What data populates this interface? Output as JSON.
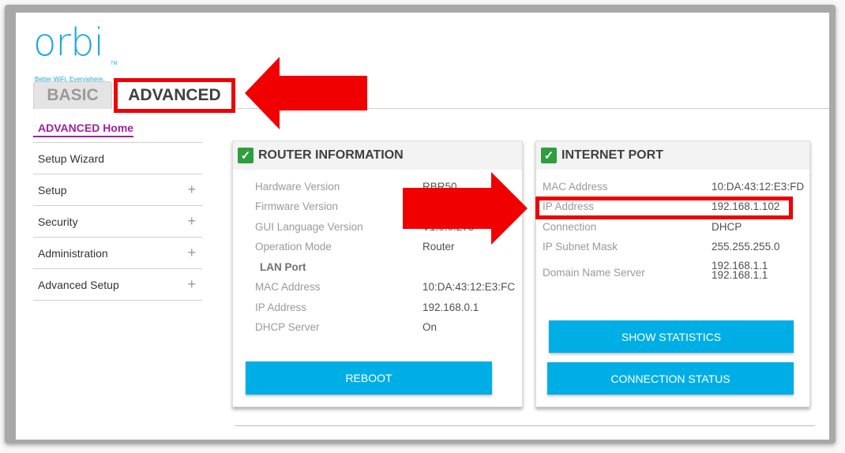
{
  "brand": {
    "logo_text": "orbi",
    "trademark": "TM",
    "tagline": "Better WiFi. Everywhere."
  },
  "tabs": [
    {
      "label": "BASIC",
      "active": false
    },
    {
      "label": "ADVANCED",
      "active": true
    }
  ],
  "sidebar": {
    "home": "ADVANCED Home",
    "items": [
      {
        "label": "Setup Wizard",
        "expandable": false
      },
      {
        "label": "Setup",
        "expandable": true
      },
      {
        "label": "Security",
        "expandable": true
      },
      {
        "label": "Administration",
        "expandable": true
      },
      {
        "label": "Advanced Setup",
        "expandable": true
      }
    ],
    "expand_glyph": "+"
  },
  "router_info": {
    "title": "ROUTER INFORMATION",
    "status_icon": "check-icon",
    "rows": [
      {
        "label": "Hardware Version",
        "value": "RBR50"
      },
      {
        "label": "Firmware Version",
        "value": ""
      },
      {
        "label": "GUI Language Version",
        "value": "V1.0.0.275"
      },
      {
        "label": "Operation Mode",
        "value": "Router"
      }
    ],
    "lan_port_heading": "LAN Port",
    "lan_rows": [
      {
        "label": "MAC Address",
        "value": "10:DA:43:12:E3:FC"
      },
      {
        "label": "IP Address",
        "value": "192.168.0.1"
      },
      {
        "label": "DHCP Server",
        "value": "On"
      }
    ],
    "reboot_button": "REBOOT"
  },
  "internet_port": {
    "title": "INTERNET PORT",
    "status_icon": "check-icon",
    "rows": [
      {
        "label": "MAC Address",
        "value": "10:DA:43:12:E3:FD"
      },
      {
        "label": "IP Address",
        "value": "192.168.1.102"
      },
      {
        "label": "Connection",
        "value": "DHCP"
      },
      {
        "label": "IP Subnet Mask",
        "value": "255.255.255.0"
      },
      {
        "label": "Domain Name Server",
        "value": "192.168.1.1",
        "value2": "192.168.1.1"
      }
    ],
    "show_statistics_button": "SHOW STATISTICS",
    "connection_status_button": "CONNECTION STATUS"
  },
  "annotations": {
    "color": "#f00000",
    "check_glyph": "✓"
  }
}
